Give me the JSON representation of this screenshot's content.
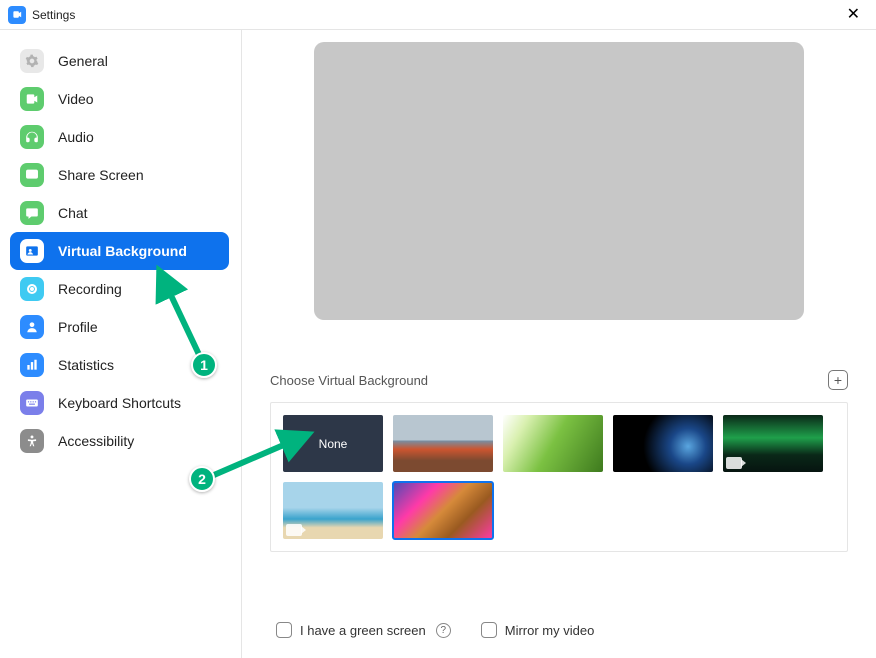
{
  "titlebar": {
    "title": "Settings"
  },
  "sidebar": {
    "items": [
      {
        "id": "general",
        "label": "General"
      },
      {
        "id": "video",
        "label": "Video"
      },
      {
        "id": "audio",
        "label": "Audio"
      },
      {
        "id": "share",
        "label": "Share Screen"
      },
      {
        "id": "chat",
        "label": "Chat"
      },
      {
        "id": "vbg",
        "label": "Virtual Background"
      },
      {
        "id": "recording",
        "label": "Recording"
      },
      {
        "id": "profile",
        "label": "Profile"
      },
      {
        "id": "statistics",
        "label": "Statistics"
      },
      {
        "id": "kbd",
        "label": "Keyboard Shortcuts"
      },
      {
        "id": "acc",
        "label": "Accessibility"
      }
    ],
    "selected": "vbg"
  },
  "content": {
    "chooser_label": "Choose Virtual Background",
    "thumbs": [
      {
        "id": "none",
        "label": "None",
        "kind": "none"
      },
      {
        "id": "bridge",
        "kind": "image"
      },
      {
        "id": "grass",
        "kind": "image"
      },
      {
        "id": "earth",
        "kind": "image"
      },
      {
        "id": "aurora",
        "kind": "video"
      },
      {
        "id": "beach",
        "kind": "video"
      },
      {
        "id": "tiger",
        "kind": "image",
        "selected": true
      }
    ],
    "options": {
      "green_screen_label": "I have a green screen",
      "mirror_label": "Mirror my video"
    }
  },
  "annotations": {
    "step1": "1",
    "step2": "2"
  }
}
